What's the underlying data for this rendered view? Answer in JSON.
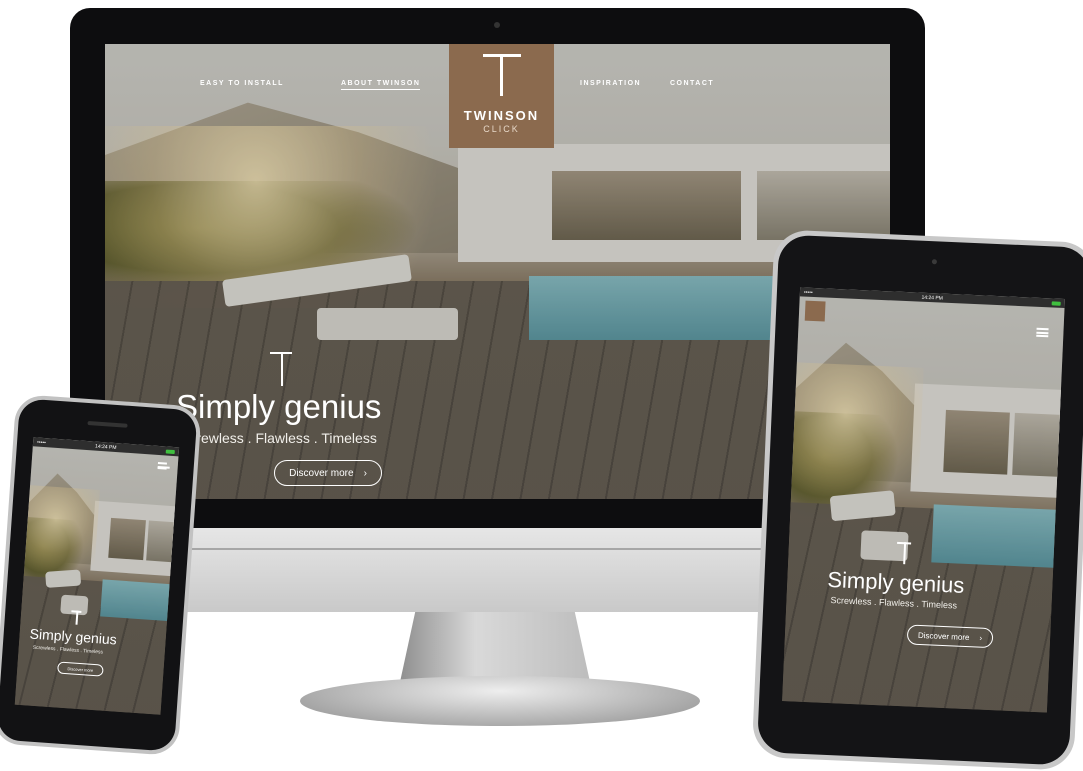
{
  "desktop": {
    "nav_left": [
      "EASY TO INSTALL",
      "ABOUT TWINSON"
    ],
    "nav_right": [
      "INSPIRATION",
      "CONTACT"
    ],
    "logo_name": "TWINSON",
    "logo_sub": "CLICK",
    "hero_title": "Simply genius",
    "hero_subtitle": "Screwless . Flawless . Timeless",
    "cta_label": "Discover more",
    "cta_icon": "chevron-right-icon"
  },
  "tablet": {
    "carrier": "•••••",
    "time": "14:24 PM",
    "hero_title": "Simply genius",
    "hero_subtitle": "Screwless . Flawless . Timeless",
    "cta_label": "Discover more"
  },
  "phone": {
    "carrier": "•••••",
    "time": "14:24 PM",
    "hero_title": "Simply genius",
    "hero_subtitle": "Screwless . Flawless . Timeless",
    "cta_label": "Discover more"
  },
  "colors": {
    "logo_brown": "#8b6a4e",
    "device_black": "#0d0d0f",
    "battery_green": "#3fbf3f"
  }
}
